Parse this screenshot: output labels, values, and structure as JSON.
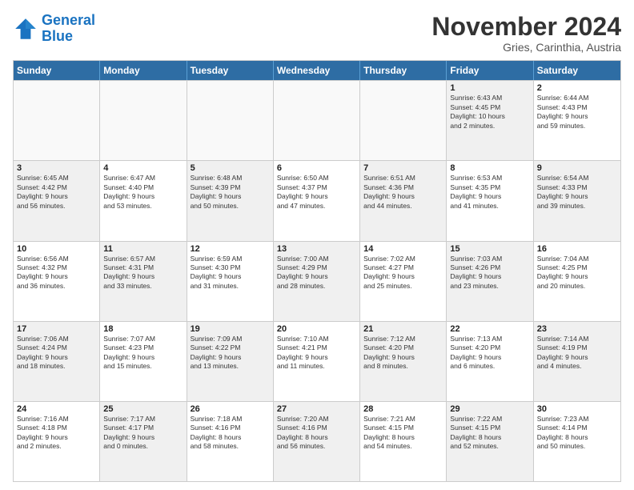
{
  "logo": {
    "line1": "General",
    "line2": "Blue"
  },
  "title": "November 2024",
  "subtitle": "Gries, Carinthia, Austria",
  "weekdays": [
    "Sunday",
    "Monday",
    "Tuesday",
    "Wednesday",
    "Thursday",
    "Friday",
    "Saturday"
  ],
  "rows": [
    [
      {
        "day": "",
        "info": "",
        "empty": true
      },
      {
        "day": "",
        "info": "",
        "empty": true
      },
      {
        "day": "",
        "info": "",
        "empty": true
      },
      {
        "day": "",
        "info": "",
        "empty": true
      },
      {
        "day": "",
        "info": "",
        "empty": true
      },
      {
        "day": "1",
        "info": "Sunrise: 6:43 AM\nSunset: 4:45 PM\nDaylight: 10 hours\nand 2 minutes.",
        "shaded": true
      },
      {
        "day": "2",
        "info": "Sunrise: 6:44 AM\nSunset: 4:43 PM\nDaylight: 9 hours\nand 59 minutes.",
        "shaded": false
      }
    ],
    [
      {
        "day": "3",
        "info": "Sunrise: 6:45 AM\nSunset: 4:42 PM\nDaylight: 9 hours\nand 56 minutes.",
        "shaded": true
      },
      {
        "day": "4",
        "info": "Sunrise: 6:47 AM\nSunset: 4:40 PM\nDaylight: 9 hours\nand 53 minutes.",
        "shaded": false
      },
      {
        "day": "5",
        "info": "Sunrise: 6:48 AM\nSunset: 4:39 PM\nDaylight: 9 hours\nand 50 minutes.",
        "shaded": true
      },
      {
        "day": "6",
        "info": "Sunrise: 6:50 AM\nSunset: 4:37 PM\nDaylight: 9 hours\nand 47 minutes.",
        "shaded": false
      },
      {
        "day": "7",
        "info": "Sunrise: 6:51 AM\nSunset: 4:36 PM\nDaylight: 9 hours\nand 44 minutes.",
        "shaded": true
      },
      {
        "day": "8",
        "info": "Sunrise: 6:53 AM\nSunset: 4:35 PM\nDaylight: 9 hours\nand 41 minutes.",
        "shaded": false
      },
      {
        "day": "9",
        "info": "Sunrise: 6:54 AM\nSunset: 4:33 PM\nDaylight: 9 hours\nand 39 minutes.",
        "shaded": true
      }
    ],
    [
      {
        "day": "10",
        "info": "Sunrise: 6:56 AM\nSunset: 4:32 PM\nDaylight: 9 hours\nand 36 minutes.",
        "shaded": false
      },
      {
        "day": "11",
        "info": "Sunrise: 6:57 AM\nSunset: 4:31 PM\nDaylight: 9 hours\nand 33 minutes.",
        "shaded": true
      },
      {
        "day": "12",
        "info": "Sunrise: 6:59 AM\nSunset: 4:30 PM\nDaylight: 9 hours\nand 31 minutes.",
        "shaded": false
      },
      {
        "day": "13",
        "info": "Sunrise: 7:00 AM\nSunset: 4:29 PM\nDaylight: 9 hours\nand 28 minutes.",
        "shaded": true
      },
      {
        "day": "14",
        "info": "Sunrise: 7:02 AM\nSunset: 4:27 PM\nDaylight: 9 hours\nand 25 minutes.",
        "shaded": false
      },
      {
        "day": "15",
        "info": "Sunrise: 7:03 AM\nSunset: 4:26 PM\nDaylight: 9 hours\nand 23 minutes.",
        "shaded": true
      },
      {
        "day": "16",
        "info": "Sunrise: 7:04 AM\nSunset: 4:25 PM\nDaylight: 9 hours\nand 20 minutes.",
        "shaded": false
      }
    ],
    [
      {
        "day": "17",
        "info": "Sunrise: 7:06 AM\nSunset: 4:24 PM\nDaylight: 9 hours\nand 18 minutes.",
        "shaded": true
      },
      {
        "day": "18",
        "info": "Sunrise: 7:07 AM\nSunset: 4:23 PM\nDaylight: 9 hours\nand 15 minutes.",
        "shaded": false
      },
      {
        "day": "19",
        "info": "Sunrise: 7:09 AM\nSunset: 4:22 PM\nDaylight: 9 hours\nand 13 minutes.",
        "shaded": true
      },
      {
        "day": "20",
        "info": "Sunrise: 7:10 AM\nSunset: 4:21 PM\nDaylight: 9 hours\nand 11 minutes.",
        "shaded": false
      },
      {
        "day": "21",
        "info": "Sunrise: 7:12 AM\nSunset: 4:20 PM\nDaylight: 9 hours\nand 8 minutes.",
        "shaded": true
      },
      {
        "day": "22",
        "info": "Sunrise: 7:13 AM\nSunset: 4:20 PM\nDaylight: 9 hours\nand 6 minutes.",
        "shaded": false
      },
      {
        "day": "23",
        "info": "Sunrise: 7:14 AM\nSunset: 4:19 PM\nDaylight: 9 hours\nand 4 minutes.",
        "shaded": true
      }
    ],
    [
      {
        "day": "24",
        "info": "Sunrise: 7:16 AM\nSunset: 4:18 PM\nDaylight: 9 hours\nand 2 minutes.",
        "shaded": false
      },
      {
        "day": "25",
        "info": "Sunrise: 7:17 AM\nSunset: 4:17 PM\nDaylight: 9 hours\nand 0 minutes.",
        "shaded": true
      },
      {
        "day": "26",
        "info": "Sunrise: 7:18 AM\nSunset: 4:16 PM\nDaylight: 8 hours\nand 58 minutes.",
        "shaded": false
      },
      {
        "day": "27",
        "info": "Sunrise: 7:20 AM\nSunset: 4:16 PM\nDaylight: 8 hours\nand 56 minutes.",
        "shaded": true
      },
      {
        "day": "28",
        "info": "Sunrise: 7:21 AM\nSunset: 4:15 PM\nDaylight: 8 hours\nand 54 minutes.",
        "shaded": false
      },
      {
        "day": "29",
        "info": "Sunrise: 7:22 AM\nSunset: 4:15 PM\nDaylight: 8 hours\nand 52 minutes.",
        "shaded": true
      },
      {
        "day": "30",
        "info": "Sunrise: 7:23 AM\nSunset: 4:14 PM\nDaylight: 8 hours\nand 50 minutes.",
        "shaded": false
      }
    ]
  ]
}
